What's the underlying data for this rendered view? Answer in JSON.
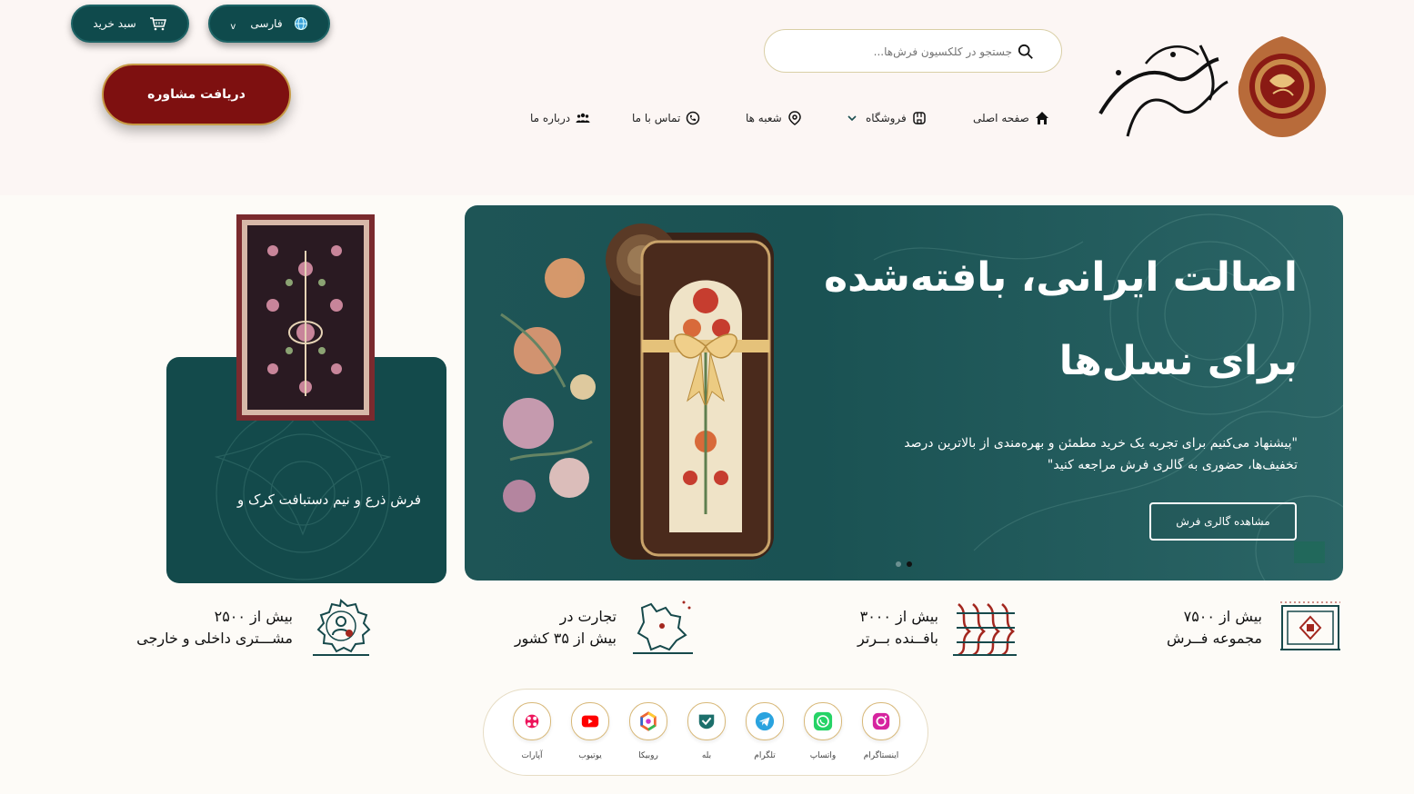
{
  "header": {
    "search": {
      "placeholder": "جستجو در کلکسیون فرش‌ها..."
    },
    "nav": [
      {
        "label": "صفحه اصلی",
        "icon": "home-icon"
      },
      {
        "label": "فروشگاه",
        "icon": "store-icon"
      },
      {
        "label": "شعبه ها",
        "icon": "location-pin-icon"
      },
      {
        "label": "تماس با ما",
        "icon": "phone-icon"
      },
      {
        "label": "درباره ما",
        "icon": "people-icon"
      }
    ],
    "cart_label": "سبد خرید",
    "language_label": "فارسی",
    "language_chevron": "v",
    "consult_label": "دریافت مشاوره"
  },
  "hero": {
    "title_line1": "اصالت ایرانی، بافته‌شده",
    "title_line2": "برای نسل‌ها",
    "description": "\"پیشنهاد می‌کنیم برای تجربه یک خرید مطمئن و بهره‌مندی از بالاترین درصد تخفیف‌ها، حضوری به گالری فرش مراجعه کنید\"",
    "button_label": "مشاهده گالری فرش"
  },
  "side_card": {
    "title": "فرش ذرع و نیم دستبافت کرک و"
  },
  "stats": [
    {
      "line1": "بیش از ۷۵۰۰",
      "line2": "مجموعه فــرش",
      "icon": "carpet-icon"
    },
    {
      "line1": "بیش از ۳۰۰۰",
      "line2": "بافــنده بــرتر",
      "icon": "weave-pattern-icon"
    },
    {
      "line1": "تجارت در",
      "line2": "بیش از ۳۵ کشور",
      "icon": "map-icon"
    },
    {
      "line1": "بیش از ۲۵۰۰",
      "line2": "مشـــتری داخلی و خارجی",
      "icon": "customer-badge-icon"
    }
  ],
  "social": [
    {
      "label": "اینستاگرام",
      "icon": "instagram-icon"
    },
    {
      "label": "واتساپ",
      "icon": "whatsapp-icon"
    },
    {
      "label": "تلگرام",
      "icon": "telegram-icon"
    },
    {
      "label": "بله",
      "icon": "bale-icon"
    },
    {
      "label": "روبیکا",
      "icon": "rubika-icon"
    },
    {
      "label": "یوتیوب",
      "icon": "youtube-icon"
    },
    {
      "label": "آپارات",
      "icon": "aparat-icon"
    }
  ],
  "colors": {
    "teal": "#0f4a4c",
    "maroon": "#7e1010",
    "gold": "#c79a45"
  }
}
